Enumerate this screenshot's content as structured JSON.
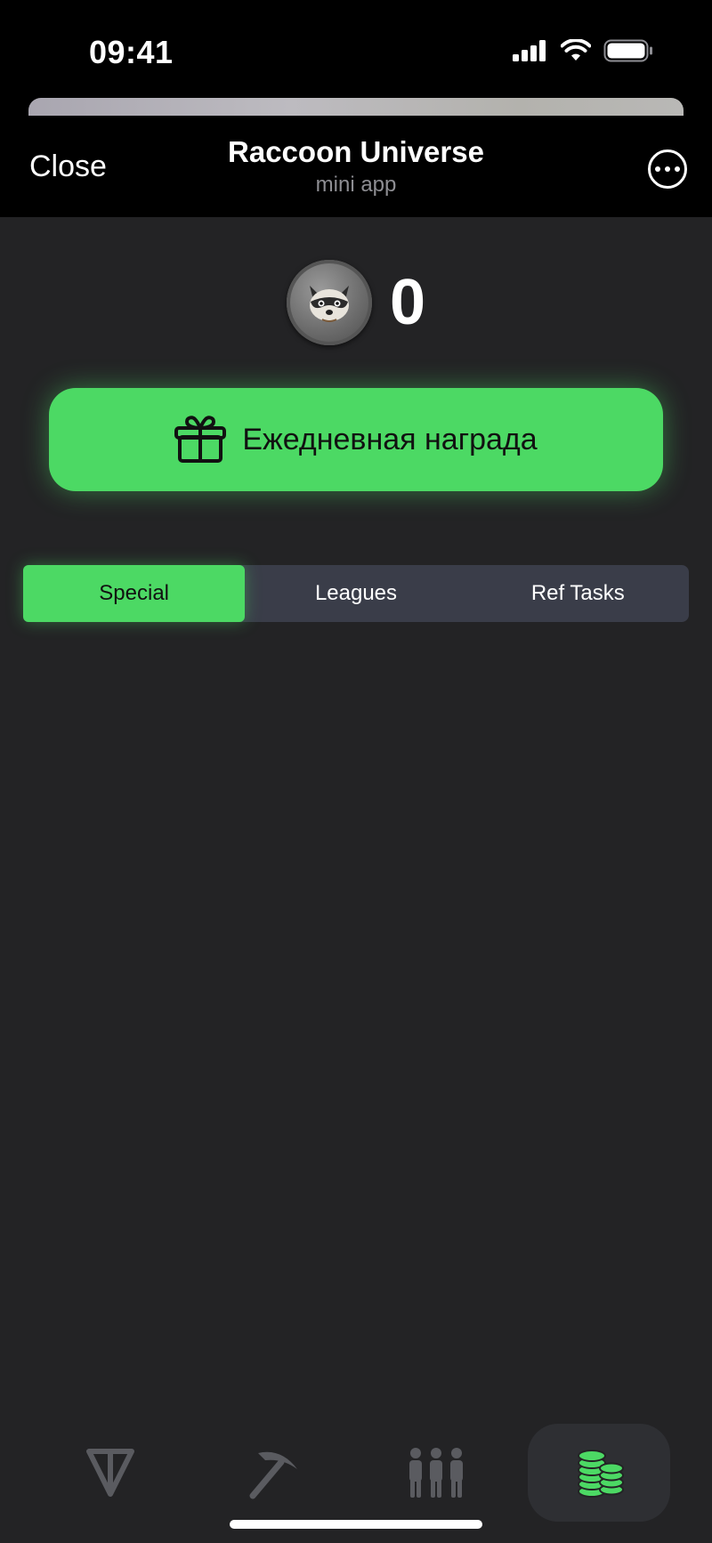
{
  "status_bar": {
    "time": "09:41"
  },
  "header": {
    "close_label": "Close",
    "title": "Raccoon Universe",
    "subtitle": "mini app"
  },
  "balance": {
    "value": "0",
    "coin_icon": "raccoon-coin-icon"
  },
  "daily_reward": {
    "label": "Ежедневная награда",
    "icon": "gift-icon"
  },
  "tabs": [
    {
      "label": "Special",
      "active": true
    },
    {
      "label": "Leagues",
      "active": false
    },
    {
      "label": "Ref Tasks",
      "active": false
    }
  ],
  "bottom_nav": [
    {
      "icon": "ton-icon",
      "active": false
    },
    {
      "icon": "pickaxe-icon",
      "active": false
    },
    {
      "icon": "friends-icon",
      "active": false
    },
    {
      "icon": "coins-stack-icon",
      "active": true
    }
  ],
  "colors": {
    "accent": "#4cd964",
    "background": "#232325",
    "tab_bg": "#3a3d49",
    "inactive_icon": "#5a5b60"
  }
}
